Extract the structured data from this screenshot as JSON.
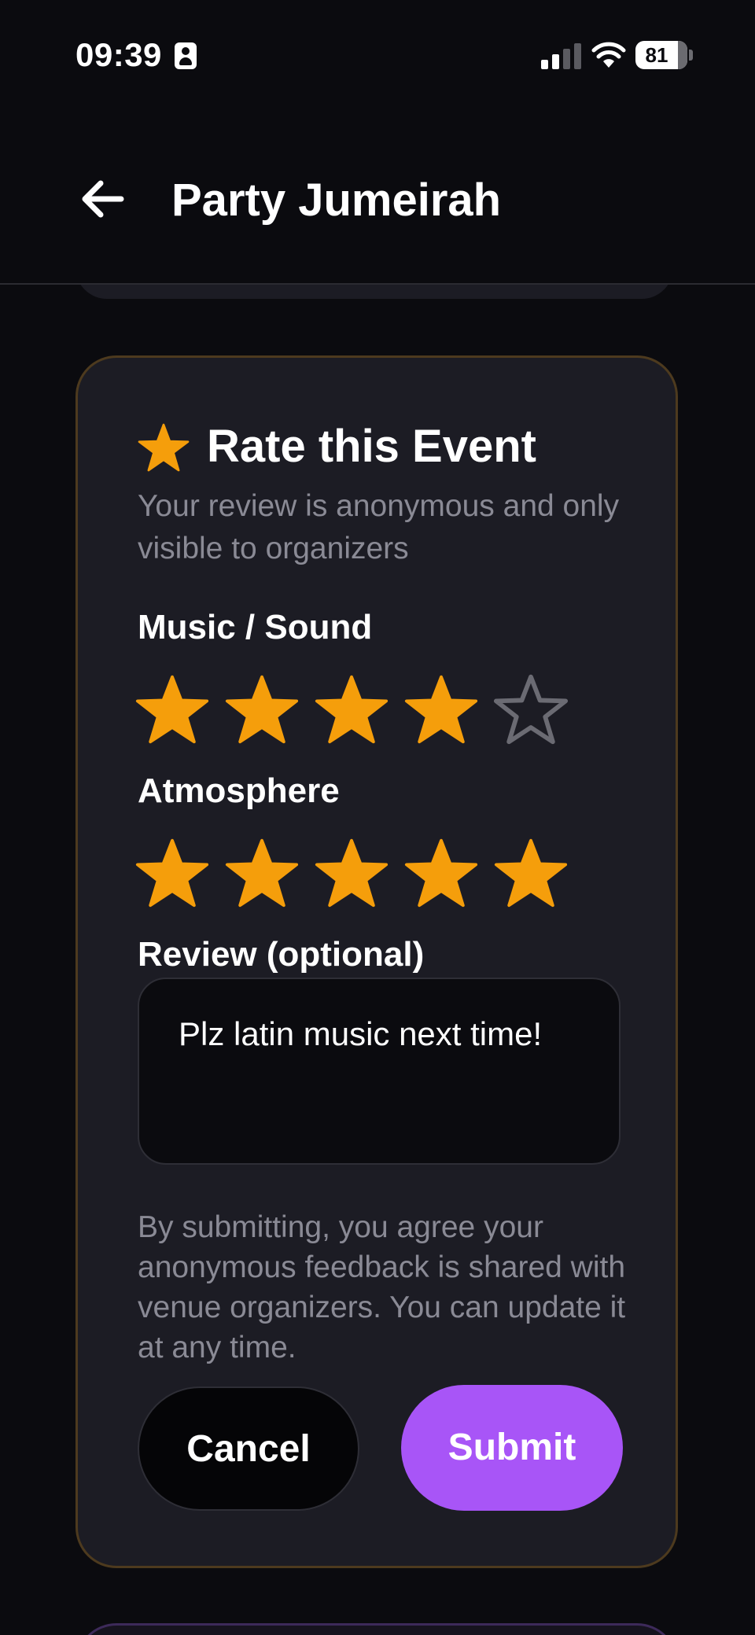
{
  "status_bar": {
    "time": "09:39",
    "battery_level": "81",
    "signal_bars_active": 2,
    "signal_bars_total": 4
  },
  "header": {
    "title": "Party Jumeirah",
    "back_icon": "arrow-left-icon"
  },
  "rating_card": {
    "title": "Rate this Event",
    "title_icon": "star-icon",
    "subtitle": "Your review is anonymous and only visible to organizers",
    "colors": {
      "star_filled": "#f59e0b",
      "star_empty": "#6b6b73",
      "accent_border": "#4d3a1e",
      "submit": "#a855f7"
    },
    "categories": [
      {
        "label": "Music / Sound",
        "rating": 4,
        "max": 5
      },
      {
        "label": "Atmosphere",
        "rating": 5,
        "max": 5
      }
    ],
    "review": {
      "label": "Review (optional)",
      "value": "Plz latin music next time!"
    },
    "disclaimer": "By submitting, you agree your anonymous feedback is shared with venue organizers. You can update it at any time.",
    "cancel_label": "Cancel",
    "submit_label": "Submit"
  }
}
